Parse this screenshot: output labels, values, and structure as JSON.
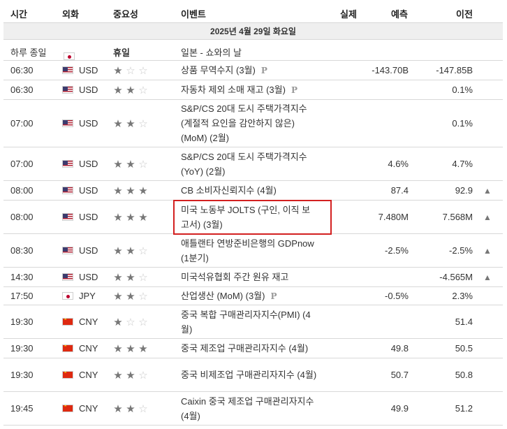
{
  "header": {
    "time": "시간",
    "currency": "외화",
    "importance": "중요성",
    "event": "이벤트",
    "actual": "실제",
    "forecast": "예측",
    "previous": "이전"
  },
  "date": "2025년 4월 29일 화요일",
  "holiday": {
    "time": "하루 종일",
    "flag": "jp",
    "label": "휴일",
    "event": "일본 - 쇼와의 날"
  },
  "rows": [
    {
      "time": "06:30",
      "flag": "us",
      "currency": "USD",
      "stars": 1,
      "event": "상품 무역수지 (3월)",
      "prelim": "P",
      "actual": "",
      "forecast": "-143.70B",
      "previous": "-147.85B",
      "bell": ""
    },
    {
      "time": "06:30",
      "flag": "us",
      "currency": "USD",
      "stars": 2,
      "event": "자동차 제외 소매 재고 (3월)",
      "prelim": "P",
      "actual": "",
      "forecast": "",
      "previous": "0.1%",
      "bell": ""
    },
    {
      "time": "07:00",
      "flag": "us",
      "currency": "USD",
      "stars": 2,
      "event": "S&P/CS 20대 도시 주택가격지수 (계절적 요인을 감안하지 않은) (MoM) (2월)",
      "prelim": "",
      "actual": "",
      "forecast": "",
      "previous": "0.1%",
      "bell": ""
    },
    {
      "time": "07:00",
      "flag": "us",
      "currency": "USD",
      "stars": 2,
      "event": "S&P/CS 20대 도시 주택가격지수 (YoY) (2월)",
      "prelim": "",
      "actual": "",
      "forecast": "4.6%",
      "previous": "4.7%",
      "bell": ""
    },
    {
      "time": "08:00",
      "flag": "us",
      "currency": "USD",
      "stars": 3,
      "event": "CB 소비자신뢰지수 (4월)",
      "prelim": "",
      "actual": "",
      "forecast": "87.4",
      "previous": "92.9",
      "bell": "bell"
    },
    {
      "time": "08:00",
      "flag": "us",
      "currency": "USD",
      "stars": 3,
      "event": "미국 노동부 JOLTS (구인, 이직 보고서) (3월)",
      "prelim": "",
      "actual": "",
      "forecast": "7.480M",
      "previous": "7.568M",
      "bell": "bell"
    },
    {
      "time": "08:30",
      "flag": "us",
      "currency": "USD",
      "stars": 2,
      "event": "애틀랜타 연방준비은행의 GDPnow (1분기)",
      "prelim": "",
      "actual": "",
      "forecast": "-2.5%",
      "previous": "-2.5%",
      "bell": "bell"
    },
    {
      "time": "14:30",
      "flag": "us",
      "currency": "USD",
      "stars": 2,
      "event": "미국석유협회 주간 원유 재고",
      "prelim": "",
      "actual": "",
      "forecast": "",
      "previous": "-4.565M",
      "bell": "bell"
    },
    {
      "time": "17:50",
      "flag": "jp",
      "currency": "JPY",
      "stars": 2,
      "event": "산업생산 (MoM) (3월)",
      "prelim": "P",
      "actual": "",
      "forecast": "-0.5%",
      "previous": "2.3%",
      "bell": ""
    },
    {
      "time": "19:30",
      "flag": "cn",
      "currency": "CNY",
      "stars": 1,
      "event": "중국 복합 구매관리자지수(PMI) (4월)",
      "prelim": "",
      "actual": "",
      "forecast": "",
      "previous": "51.4",
      "bell": ""
    },
    {
      "time": "19:30",
      "flag": "cn",
      "currency": "CNY",
      "stars": 3,
      "event": "중국 제조업 구매관리자지수 (4월)",
      "prelim": "",
      "actual": "",
      "forecast": "49.8",
      "previous": "50.5",
      "bell": ""
    },
    {
      "time": "19:30",
      "flag": "cn",
      "currency": "CNY",
      "stars": 2,
      "event": "중국 비제조업 구매관리자지수 (4월)",
      "prelim": "",
      "actual": "",
      "forecast": "50.7",
      "previous": "50.8",
      "bell": ""
    },
    {
      "time": "19:45",
      "flag": "cn",
      "currency": "CNY",
      "stars": 2,
      "event": "Caixin 중국 제조업 구매관리자지수 (4월)",
      "prelim": "",
      "actual": "",
      "forecast": "49.9",
      "previous": "51.2",
      "bell": ""
    }
  ]
}
